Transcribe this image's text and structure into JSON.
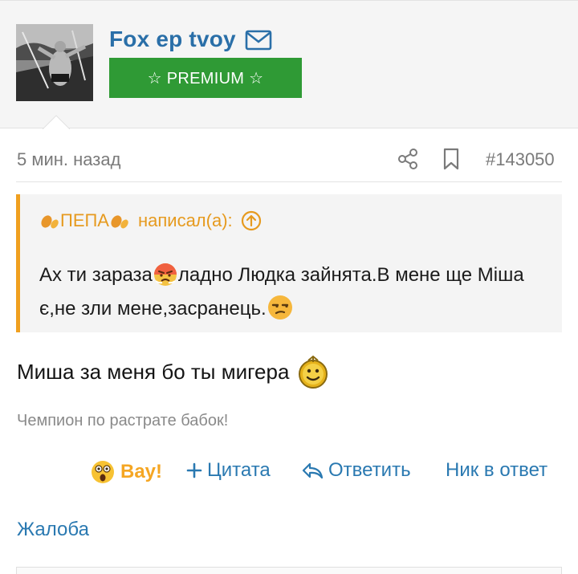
{
  "user": {
    "name": "Fox ep tvoy",
    "badge": "☆ PREMIUM ☆"
  },
  "post": {
    "time": "5 мин. назад",
    "number": "#143050"
  },
  "quote": {
    "author": "ПЕПА",
    "wrote": "написал(а):",
    "text_part1": "Ах ти зараза",
    "text_part2": "ладно Людка зайнята.В мене ще Міша є,не зли мене,засранець."
  },
  "message": {
    "text": "Миша за меня бо ты мигера"
  },
  "signature": "Чемпион по растрате бабок!",
  "actions": {
    "vau": "Вау!",
    "quote": "Цитата",
    "reply": "Ответить",
    "nick": "Ник в ответ"
  },
  "complaint": "Жалоба",
  "colors": {
    "link": "#2a79b1",
    "username": "#2a6fa8",
    "premium": "#2f9a35",
    "quote_accent": "#f0a020"
  },
  "icons": [
    "mail-icon",
    "share-icon",
    "bookmark-icon",
    "arrow-up-circle-icon",
    "leaf-icon",
    "angry-emoji",
    "unamused-emoji",
    "smiley-emoji",
    "astonished-emoji",
    "plus-icon",
    "reply-arrow-icon"
  ]
}
